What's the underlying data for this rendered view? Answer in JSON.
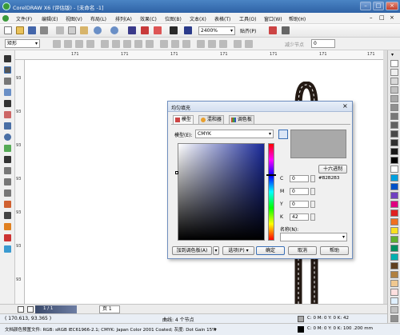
{
  "window": {
    "title": "CorelDRAW X6 (评估版) - [未命名 -1]",
    "btn_min": "–",
    "btn_max": "□",
    "btn_close": "×",
    "doc_min": "–",
    "doc_max": "□",
    "doc_close": "×"
  },
  "menu": [
    "文件(F)",
    "编辑(E)",
    "视图(V)",
    "布局(L)",
    "排列(A)",
    "效果(C)",
    "位图(B)",
    "文本(X)",
    "表格(T)",
    "工具(O)",
    "窗口(W)",
    "帮助(H)"
  ],
  "toolbar": {
    "zoom_value": "2400%",
    "snap_label": "贴齐(P)",
    "dropdown_arrow": "▾"
  },
  "propbar": {
    "preset_value": "矩形",
    "reduce_nodes": "减少节点",
    "node_count": "0"
  },
  "ruler": {
    "h_ticks": [
      "171",
      "171",
      "171",
      "171",
      "171",
      "171",
      "171"
    ],
    "v_ticks": [
      "93",
      "93",
      "93",
      "93",
      "93",
      "93",
      "93"
    ]
  },
  "page_bar": {
    "page_number": "1 / 1",
    "tab_label": "页 1"
  },
  "status": {
    "coordinates": "( 170.613, 93.365 )",
    "curve_info": "曲线: 4 个节点",
    "fill_info": "C: 0 M: 0 Y: 0 K: 42",
    "outline_info": "C: 0 M: 0 Y: 0 K: 100  .200 mm",
    "profile_text": "文档颜色预置文件: RGB: sRGB IEC61966-2.1; CMYK: Japan Color 2001 Coated; 灰度: Dot Gain 15%",
    "arrow": "▸"
  },
  "dialog": {
    "title": "均匀填充",
    "close": "×",
    "tabs": [
      "模型",
      "混和器",
      "调色板"
    ],
    "model_label": "模型(E):",
    "model_value": "CMYK",
    "old_new_button": "十六进制",
    "cmyk": [
      {
        "label": "C",
        "value": "0"
      },
      {
        "label": "M",
        "value": "0"
      },
      {
        "label": "Y",
        "value": "0"
      },
      {
        "label": "K",
        "value": "42"
      }
    ],
    "hex_value": "#B2B2B3",
    "name_label": "名称(N):",
    "name_value": "",
    "add_palette": "加到调色板(A)",
    "options": "选项(P)",
    "ok": "确定",
    "cancel": "取消",
    "help": "帮助",
    "sample_color": "#a9a9a9"
  },
  "palette_colors": [
    "#ffffff",
    "#f0f0f0",
    "#d8d8d8",
    "#c0c0c0",
    "#a8a8a8",
    "#909090",
    "#787878",
    "#606060",
    "#484848",
    "#303030",
    "#181818",
    "#000000",
    "#ffffff",
    "#00a0e0",
    "#0050c8",
    "#7040c0",
    "#e00080",
    "#e02020",
    "#f07020",
    "#f8e020",
    "#60b030",
    "#009060",
    "#00b0b0",
    "#604020",
    "#b08040",
    "#f0c890",
    "#ffe0e0",
    "#e0f0ff",
    "#c0c0c0",
    "#909090"
  ],
  "colors": {
    "title_blue": "#2f63a6",
    "accent_blue": "#3a6fb5",
    "object_fill": "#241a14",
    "object_stitch": "#ffffff"
  }
}
